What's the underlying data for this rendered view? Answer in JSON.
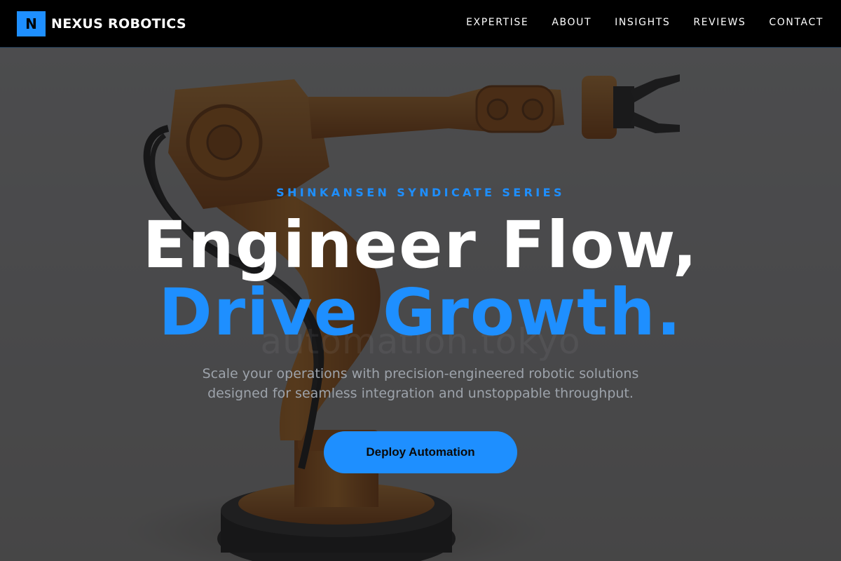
{
  "brand": {
    "mark": "N",
    "name": "NEXUS ROBOTICS",
    "accent_color": "#1e8fff"
  },
  "nav": {
    "items": [
      {
        "label": "EXPERTISE"
      },
      {
        "label": "ABOUT"
      },
      {
        "label": "INSIGHTS"
      },
      {
        "label": "REVIEWS"
      },
      {
        "label": "CONTACT"
      }
    ]
  },
  "hero": {
    "eyebrow": "SHINKANSEN SYNDICATE SERIES",
    "headline_line1": "Engineer Flow,",
    "headline_line2": "Drive Growth.",
    "subtext_line1": "Scale your operations with precision-engineered robotic solutions",
    "subtext_line2": "designed for seamless integration and unstoppable throughput.",
    "cta_label": "Deploy Automation",
    "watermark": "automation.tokyo",
    "background_image": "orange-industrial-robot-arm"
  }
}
